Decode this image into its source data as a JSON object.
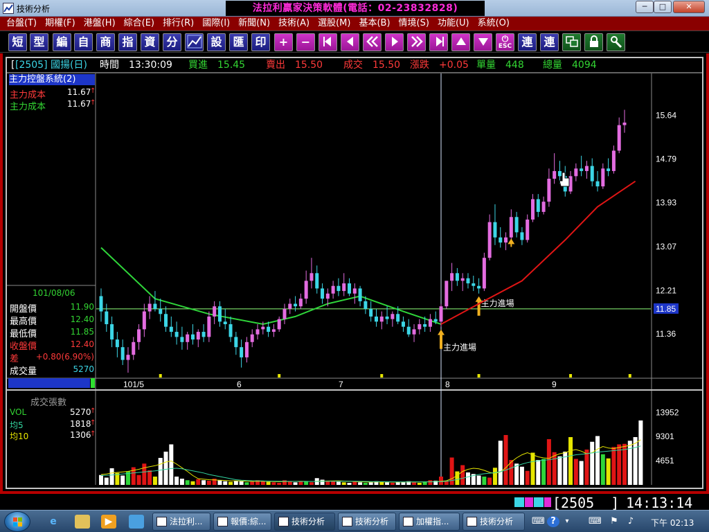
{
  "window": {
    "title": "技術分析",
    "promo": "法拉利贏家決策軟體(電話：02-23832828)",
    "minimize": "─",
    "maximize": "□",
    "close": "✕"
  },
  "menu": [
    "台盤(T)",
    "期權(F)",
    "港盤(H)",
    "綜合(E)",
    "排行(R)",
    "國際(I)",
    "新聞(N)",
    "技術(A)",
    "選股(M)",
    "基本(B)",
    "情境(S)",
    "功能(U)",
    "系統(O)"
  ],
  "toolbar": {
    "text_buttons": [
      "短",
      "型",
      "編",
      "自",
      "商",
      "指",
      "資",
      "分"
    ],
    "settings": "設",
    "import": "匯",
    "print": "印",
    "zoom_in": "+",
    "zoom_out": "−",
    "esc": "ESC",
    "link1": "連",
    "link2": "連"
  },
  "quote": {
    "symbol": "[2505]  國揚(日)",
    "time_label": "時間",
    "time": "13:30:09",
    "bid_label": "買進",
    "bid": "15.45",
    "ask_label": "賣出",
    "ask": "15.50",
    "deal_label": "成交",
    "deal": "15.50",
    "change_label": "漲跌",
    "change": "+0.05",
    "vol_label": "單量",
    "vol": "448",
    "total_label": "總量",
    "total": "4094"
  },
  "indicator": {
    "title": "主力控盤系統(2)",
    "line1_label": "主力成本",
    "line1_value": "11.67",
    "line2_label": "主力成本",
    "line2_value": "11.67",
    "arrow": "↑"
  },
  "ohlc": {
    "date": "101/08/06",
    "open_label": "開盤價",
    "open": "11.90",
    "high_label": "最高價",
    "high": "12.40",
    "low_label": "最低價",
    "low": "11.85",
    "close_label": "收盤價",
    "close": "12.40",
    "diff_label": "差",
    "diff": "+0.80(6.90%)",
    "volume_label": "成交量",
    "volume": "5270"
  },
  "price_axis": [
    "15.64",
    "14.79",
    "13.93",
    "13.07",
    "12.21",
    "11.85",
    "11.36"
  ],
  "date_axis": [
    "101/5",
    "6",
    "7",
    "8",
    "9"
  ],
  "signals": [
    "主力進場",
    "主力進場"
  ],
  "volume_panel": {
    "title": "成交張數",
    "vol_label": "VOL",
    "vol": "5270",
    "ma5_label": "均5",
    "ma5": "1818",
    "ma10_label": "均10",
    "ma10": "1306",
    "axis": [
      "13952",
      "9301",
      "4651"
    ]
  },
  "status": {
    "code": "[2505_  ]",
    "time": "14:13:14"
  },
  "taskbar": {
    "tasks": [
      "法拉利...",
      "報價:綜...",
      "技術分析",
      "技術分析",
      "加權指...",
      "技術分析"
    ],
    "clock": "下午 02:13"
  },
  "chart_data": [
    {
      "type": "candlestick",
      "title": "",
      "price_range": [
        10.6,
        16.3
      ],
      "highlight_price": 11.85,
      "y_ticks": [
        15.64,
        14.79,
        13.93,
        13.07,
        12.21,
        11.36
      ],
      "x_labels": [
        "101/5",
        "6",
        "7",
        "8",
        "9"
      ],
      "candles": [
        {
          "o": 12.1,
          "h": 12.25,
          "l": 11.6,
          "c": 11.8
        },
        {
          "o": 11.8,
          "h": 11.95,
          "l": 11.4,
          "c": 11.55
        },
        {
          "o": 11.55,
          "h": 11.7,
          "l": 11.1,
          "c": 11.25
        },
        {
          "o": 11.25,
          "h": 11.4,
          "l": 10.9,
          "c": 11.1
        },
        {
          "o": 11.1,
          "h": 11.25,
          "l": 10.75,
          "c": 10.85
        },
        {
          "o": 10.85,
          "h": 11.1,
          "l": 10.6,
          "c": 10.95
        },
        {
          "o": 10.95,
          "h": 11.3,
          "l": 10.85,
          "c": 11.2
        },
        {
          "o": 11.2,
          "h": 11.55,
          "l": 11.05,
          "c": 11.45
        },
        {
          "o": 11.45,
          "h": 11.95,
          "l": 11.3,
          "c": 11.8
        },
        {
          "o": 11.8,
          "h": 12.1,
          "l": 11.65,
          "c": 11.95
        },
        {
          "o": 11.95,
          "h": 12.2,
          "l": 11.8,
          "c": 11.85
        },
        {
          "o": 11.85,
          "h": 12.05,
          "l": 11.6,
          "c": 11.75
        },
        {
          "o": 11.75,
          "h": 11.9,
          "l": 11.4,
          "c": 11.5
        },
        {
          "o": 11.5,
          "h": 11.7,
          "l": 11.3,
          "c": 11.4
        },
        {
          "o": 11.4,
          "h": 11.6,
          "l": 11.15,
          "c": 11.3
        },
        {
          "o": 11.3,
          "h": 11.5,
          "l": 11.05,
          "c": 11.2
        },
        {
          "o": 11.2,
          "h": 11.4,
          "l": 11.05,
          "c": 11.35
        },
        {
          "o": 11.35,
          "h": 11.55,
          "l": 11.15,
          "c": 11.25
        },
        {
          "o": 11.25,
          "h": 11.45,
          "l": 11.1,
          "c": 11.4
        },
        {
          "o": 11.4,
          "h": 11.55,
          "l": 11.2,
          "c": 11.3
        },
        {
          "o": 11.3,
          "h": 11.8,
          "l": 11.2,
          "c": 11.7
        },
        {
          "o": 11.7,
          "h": 12.0,
          "l": 11.55,
          "c": 11.9
        },
        {
          "o": 11.9,
          "h": 12.0,
          "l": 11.5,
          "c": 11.6
        },
        {
          "o": 11.6,
          "h": 11.85,
          "l": 11.45,
          "c": 11.55
        },
        {
          "o": 11.55,
          "h": 11.7,
          "l": 11.2,
          "c": 11.3
        },
        {
          "o": 11.3,
          "h": 11.4,
          "l": 10.95,
          "c": 11.1
        },
        {
          "o": 11.1,
          "h": 11.25,
          "l": 10.7,
          "c": 10.9
        },
        {
          "o": 10.9,
          "h": 11.3,
          "l": 10.8,
          "c": 11.2
        },
        {
          "o": 11.2,
          "h": 11.45,
          "l": 11.1,
          "c": 11.35
        },
        {
          "o": 11.35,
          "h": 11.55,
          "l": 11.25,
          "c": 11.45
        },
        {
          "o": 11.45,
          "h": 11.6,
          "l": 11.35,
          "c": 11.5
        },
        {
          "o": 11.5,
          "h": 11.6,
          "l": 11.3,
          "c": 11.4
        },
        {
          "o": 11.4,
          "h": 11.55,
          "l": 11.3,
          "c": 11.45
        },
        {
          "o": 11.45,
          "h": 11.7,
          "l": 11.4,
          "c": 11.65
        },
        {
          "o": 11.65,
          "h": 11.95,
          "l": 11.55,
          "c": 11.85
        },
        {
          "o": 11.85,
          "h": 12.05,
          "l": 11.75,
          "c": 11.95
        },
        {
          "o": 11.95,
          "h": 12.1,
          "l": 11.8,
          "c": 11.9
        },
        {
          "o": 11.9,
          "h": 12.15,
          "l": 11.85,
          "c": 12.05
        },
        {
          "o": 12.05,
          "h": 12.6,
          "l": 11.95,
          "c": 12.4
        },
        {
          "o": 12.4,
          "h": 12.85,
          "l": 12.25,
          "c": 12.55
        },
        {
          "o": 12.55,
          "h": 12.7,
          "l": 12.15,
          "c": 12.25
        },
        {
          "o": 12.25,
          "h": 12.35,
          "l": 11.95,
          "c": 12.05
        },
        {
          "o": 12.05,
          "h": 12.25,
          "l": 11.9,
          "c": 12.15
        },
        {
          "o": 12.15,
          "h": 12.4,
          "l": 12.05,
          "c": 12.3
        },
        {
          "o": 12.3,
          "h": 12.45,
          "l": 12.1,
          "c": 12.2
        },
        {
          "o": 12.2,
          "h": 12.55,
          "l": 12.1,
          "c": 12.35
        },
        {
          "o": 12.35,
          "h": 12.45,
          "l": 12.1,
          "c": 12.15
        },
        {
          "o": 12.15,
          "h": 12.35,
          "l": 11.95,
          "c": 12.25
        },
        {
          "o": 12.25,
          "h": 12.3,
          "l": 11.9,
          "c": 12.0
        },
        {
          "o": 12.0,
          "h": 12.1,
          "l": 11.75,
          "c": 11.85
        },
        {
          "o": 11.85,
          "h": 12.0,
          "l": 11.6,
          "c": 11.7
        },
        {
          "o": 11.7,
          "h": 11.85,
          "l": 11.5,
          "c": 11.6
        },
        {
          "o": 11.6,
          "h": 11.8,
          "l": 11.45,
          "c": 11.7
        },
        {
          "o": 11.7,
          "h": 11.9,
          "l": 11.55,
          "c": 11.65
        },
        {
          "o": 11.65,
          "h": 11.8,
          "l": 11.5,
          "c": 11.75
        },
        {
          "o": 11.75,
          "h": 11.9,
          "l": 11.55,
          "c": 11.6
        },
        {
          "o": 11.6,
          "h": 11.7,
          "l": 11.4,
          "c": 11.5
        },
        {
          "o": 11.5,
          "h": 11.65,
          "l": 11.3,
          "c": 11.35
        },
        {
          "o": 11.35,
          "h": 11.55,
          "l": 11.2,
          "c": 11.45
        },
        {
          "o": 11.45,
          "h": 11.65,
          "l": 11.35,
          "c": 11.55
        },
        {
          "o": 11.55,
          "h": 11.7,
          "l": 11.4,
          "c": 11.5
        },
        {
          "o": 11.5,
          "h": 11.75,
          "l": 11.4,
          "c": 11.65
        },
        {
          "o": 11.65,
          "h": 11.8,
          "l": 11.55,
          "c": 11.6
        },
        {
          "o": 11.6,
          "h": 11.95,
          "l": 11.5,
          "c": 11.9
        },
        {
          "o": 11.9,
          "h": 12.4,
          "l": 11.85,
          "c": 12.4
        },
        {
          "o": 12.4,
          "h": 12.75,
          "l": 12.2,
          "c": 12.55
        },
        {
          "o": 12.55,
          "h": 12.65,
          "l": 12.3,
          "c": 12.4
        },
        {
          "o": 12.4,
          "h": 12.55,
          "l": 12.2,
          "c": 12.45
        },
        {
          "o": 12.45,
          "h": 12.55,
          "l": 12.25,
          "c": 12.35
        },
        {
          "o": 12.35,
          "h": 12.5,
          "l": 12.2,
          "c": 12.3
        },
        {
          "o": 12.3,
          "h": 12.45,
          "l": 12.15,
          "c": 12.25
        },
        {
          "o": 12.25,
          "h": 12.95,
          "l": 12.2,
          "c": 12.85
        },
        {
          "o": 12.85,
          "h": 13.7,
          "l": 12.8,
          "c": 13.55
        },
        {
          "o": 13.55,
          "h": 13.9,
          "l": 13.1,
          "c": 13.25
        },
        {
          "o": 13.25,
          "h": 13.45,
          "l": 13.05,
          "c": 13.15
        },
        {
          "o": 13.15,
          "h": 13.35,
          "l": 13.0,
          "c": 13.25
        },
        {
          "o": 13.25,
          "h": 13.8,
          "l": 13.2,
          "c": 13.65
        },
        {
          "o": 13.65,
          "h": 13.75,
          "l": 13.25,
          "c": 13.35
        },
        {
          "o": 13.35,
          "h": 13.45,
          "l": 13.1,
          "c": 13.2
        },
        {
          "o": 13.2,
          "h": 13.7,
          "l": 13.15,
          "c": 13.6
        },
        {
          "o": 13.6,
          "h": 14.1,
          "l": 13.55,
          "c": 14.0
        },
        {
          "o": 14.0,
          "h": 14.1,
          "l": 13.65,
          "c": 13.75
        },
        {
          "o": 13.75,
          "h": 14.05,
          "l": 13.7,
          "c": 13.95
        },
        {
          "o": 13.95,
          "h": 14.6,
          "l": 13.85,
          "c": 14.4
        },
        {
          "o": 14.4,
          "h": 14.9,
          "l": 14.3,
          "c": 14.55
        },
        {
          "o": 14.55,
          "h": 14.75,
          "l": 14.3,
          "c": 14.45
        },
        {
          "o": 14.45,
          "h": 14.65,
          "l": 14.05,
          "c": 14.15
        },
        {
          "o": 14.15,
          "h": 14.55,
          "l": 14.1,
          "c": 14.45
        },
        {
          "o": 14.45,
          "h": 14.7,
          "l": 14.35,
          "c": 14.6
        },
        {
          "o": 14.6,
          "h": 14.85,
          "l": 14.45,
          "c": 14.55
        },
        {
          "o": 14.55,
          "h": 14.75,
          "l": 14.4,
          "c": 14.65
        },
        {
          "o": 14.65,
          "h": 14.8,
          "l": 14.25,
          "c": 14.35
        },
        {
          "o": 14.35,
          "h": 14.55,
          "l": 14.15,
          "c": 14.25
        },
        {
          "o": 14.25,
          "h": 14.7,
          "l": 14.2,
          "c": 14.6
        },
        {
          "o": 14.6,
          "h": 14.8,
          "l": 14.45,
          "c": 14.55
        },
        {
          "o": 14.55,
          "h": 15.05,
          "l": 14.5,
          "c": 14.95
        },
        {
          "o": 14.95,
          "h": 15.6,
          "l": 14.9,
          "c": 15.45
        },
        {
          "o": 15.45,
          "h": 15.75,
          "l": 15.3,
          "c": 15.5
        }
      ],
      "main_cost_line": [
        {
          "i": 0,
          "v": 13.05
        },
        {
          "i": 10,
          "v": 12.05
        },
        {
          "i": 20,
          "v": 11.75
        },
        {
          "i": 30,
          "v": 11.55
        },
        {
          "i": 36,
          "v": 11.7
        },
        {
          "i": 42,
          "v": 11.95
        },
        {
          "i": 48,
          "v": 12.1
        },
        {
          "i": 56,
          "v": 11.8
        },
        {
          "i": 63,
          "v": 11.55
        },
        {
          "i": 70,
          "v": 11.95
        },
        {
          "i": 78,
          "v": 12.4
        },
        {
          "i": 86,
          "v": 13.2
        },
        {
          "i": 92,
          "v": 13.85
        },
        {
          "i": 99,
          "v": 14.35
        }
      ],
      "signal_marks": [
        {
          "i": 63,
          "label": "主力進場"
        },
        {
          "i": 70,
          "label": "主力進場"
        },
        {
          "i": 76,
          "label": ""
        }
      ]
    },
    {
      "type": "bar",
      "title": "成交張數",
      "ylim": [
        0,
        16000
      ],
      "y_ticks": [
        13952,
        9301,
        4651
      ],
      "values": [
        1900,
        1400,
        3200,
        2300,
        1800,
        2600,
        3400,
        1900,
        4100,
        2800,
        1600,
        5200,
        6400,
        7800,
        1600,
        1200,
        900,
        700,
        1100,
        900,
        800,
        1200,
        900,
        700,
        600,
        800,
        700,
        500,
        600,
        900,
        700,
        600,
        500,
        400,
        900,
        600,
        500,
        700,
        600,
        500,
        1300,
        1000,
        800,
        700,
        600,
        500,
        400,
        600,
        500,
        400,
        500,
        700,
        600,
        500,
        400,
        500,
        600,
        700,
        500,
        400,
        600,
        900,
        800,
        1600,
        700,
        5270,
        2600,
        3800,
        2400,
        2100,
        1800,
        1600,
        1400,
        3300,
        8500,
        9600,
        4800,
        4100,
        3500,
        2700,
        6200,
        4800,
        5000,
        8800,
        6300,
        5500,
        6400,
        9200,
        5000,
        4600,
        6800,
        8300,
        9400,
        5900,
        5100,
        7300,
        7800,
        7900,
        8500,
        9200,
        12400
      ],
      "ma5": [
        2000,
        2100,
        2300,
        2400,
        2500,
        2600,
        2800,
        3000,
        3300,
        3500,
        3700,
        4000,
        4400,
        4600,
        4000,
        3300,
        2600,
        1800,
        1200,
        1100,
        1000,
        950,
        900,
        850,
        800,
        780,
        760,
        700,
        680,
        700,
        710,
        690,
        650,
        620,
        650,
        660,
        680,
        700,
        680,
        650,
        700,
        740,
        750,
        760,
        780,
        740,
        700,
        650,
        600,
        560,
        550,
        560,
        560,
        560,
        550,
        540,
        550,
        560,
        570,
        560,
        580,
        620,
        640,
        700,
        800,
        1200,
        1800,
        2600,
        3000,
        3200,
        3100,
        2800,
        2400,
        2200,
        2500,
        3300,
        4400,
        5200,
        5800,
        6200,
        5800,
        5400,
        5200,
        5100,
        5600,
        6000,
        6200,
        6600,
        6800,
        6500,
        6000,
        6200,
        6900,
        7400,
        7100,
        7000,
        7200,
        7400,
        7600,
        8000,
        8700
      ],
      "ma10": [
        1800,
        1850,
        1900,
        2000,
        2100,
        2200,
        2300,
        2400,
        2500,
        2600,
        2700,
        2850,
        3000,
        3150,
        3200,
        3100,
        2900,
        2700,
        2500,
        2300,
        2000,
        1800,
        1600,
        1400,
        1200,
        1000,
        900,
        850,
        800,
        780,
        760,
        740,
        720,
        700,
        690,
        680,
        670,
        670,
        670,
        660,
        670,
        690,
        700,
        700,
        710,
        710,
        700,
        690,
        680,
        660,
        640,
        620,
        610,
        600,
        590,
        580,
        570,
        570,
        570,
        570,
        580,
        590,
        610,
        640,
        700,
        850,
        1050,
        1300,
        1550,
        1800,
        2000,
        2150,
        2250,
        2350,
        2550,
        2850,
        3250,
        3650,
        4000,
        4300,
        4500,
        4650,
        4750,
        4850,
        5000,
        5200,
        5400,
        5600,
        5800,
        5900,
        6000,
        6150,
        6300,
        6400,
        6500,
        6600,
        6700,
        6800,
        7000,
        7200,
        7500
      ],
      "series": [
        {
          "name": "VOL"
        },
        {
          "name": "均5"
        },
        {
          "name": "均10"
        }
      ]
    }
  ]
}
